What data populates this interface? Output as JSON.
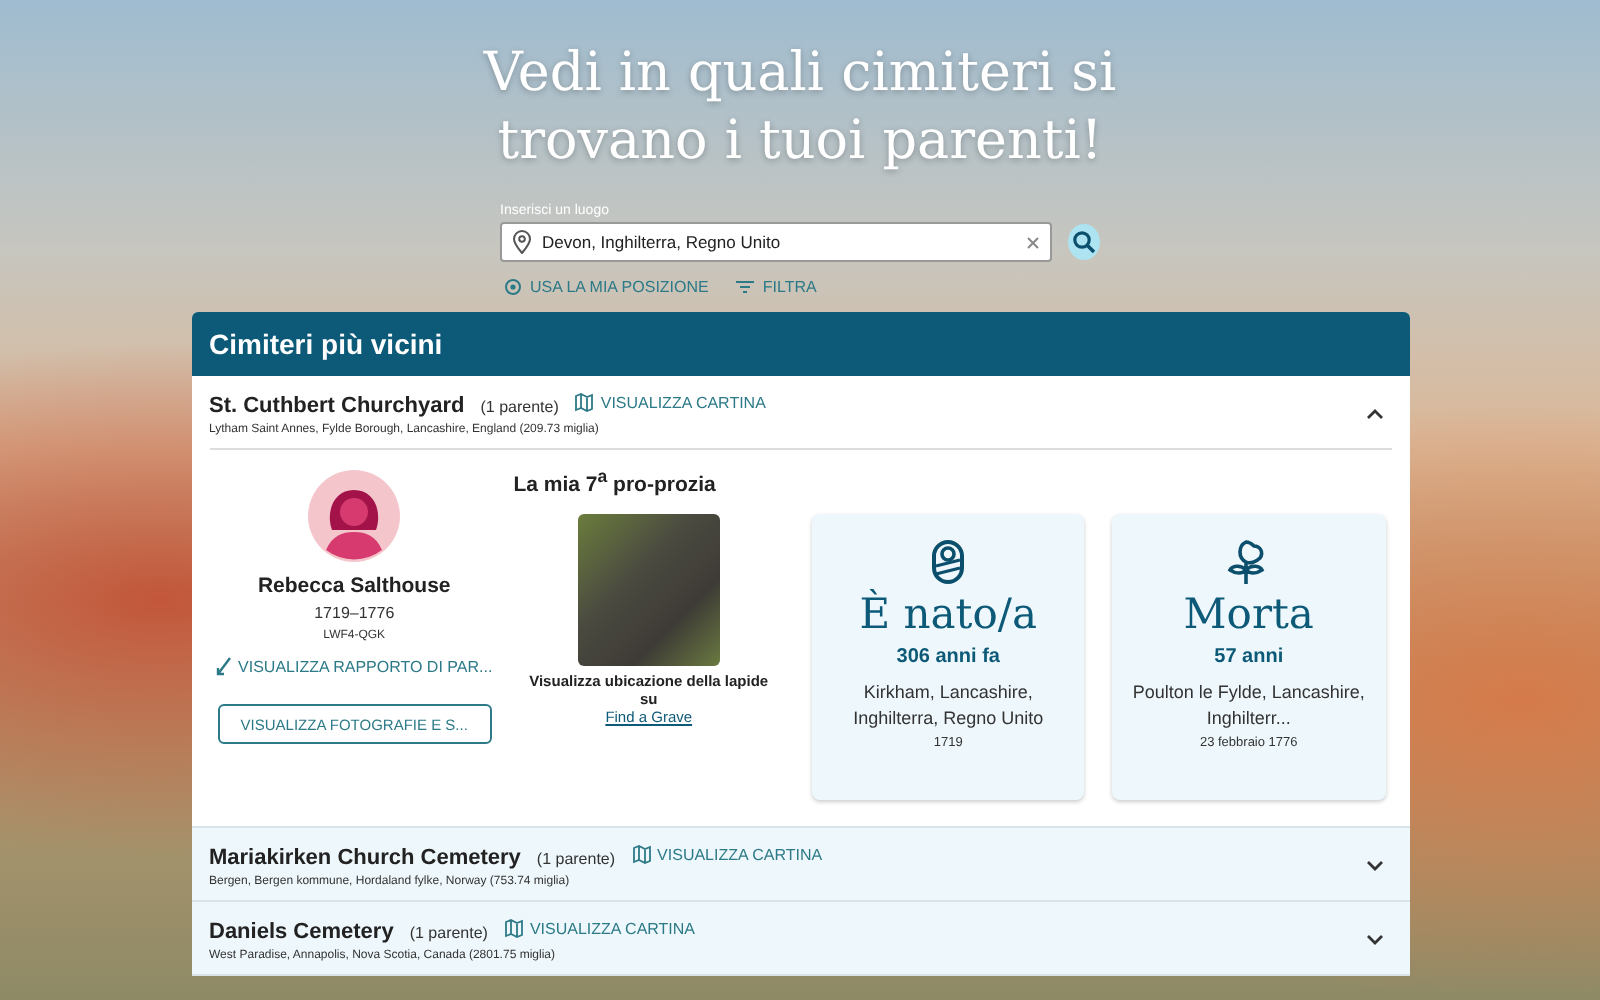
{
  "hero": {
    "title": "Vedi in quali cimiteri si trovano i tuoi parenti!"
  },
  "search": {
    "label": "Inserisci un luogo",
    "value": "Devon, Inghilterra, Regno Unito"
  },
  "search_links": [
    "USA LA MIA POSIZIONE",
    "FILTRA"
  ],
  "panel": {
    "title": "Cimiteri più vicini"
  },
  "cemeteries": [
    {
      "name": "St. Cuthbert Churchyard",
      "count": "(1 parente)",
      "map_link": "VISUALIZZA CARTINA",
      "place": "Lytham Saint Annes, Fylde Borough, Lancashire, England (209.73 miglia)",
      "expanded": true,
      "detail": {
        "person": {
          "name": "Rebecca Salthouse",
          "dates": "1719–1776",
          "id": "LWF4-QGK",
          "relationship_link": "VISUALIZZA RAPPORTO DI PAR...",
          "photos_button": "VISUALIZZA FOTOGRAFIE E S..."
        },
        "relation": "La mia 7$^{a}$ pro-prozia",
        "grave_text": "Visualizza ubicazione della lapide su",
        "grave_link": "Find a Grave",
        "events": [
          {
            "kind": "birth",
            "title": "È nato/a",
            "summary": "306 anni fa",
            "place": "Kirkham, Lancashire, Inghilterra, Regno Unito",
            "date": "1719"
          },
          {
            "kind": "death",
            "title": "Morta",
            "summary": "57 anni",
            "place": "Poulton le Fylde, Lancashire, Inghilterr...",
            "date": "23 febbraio 1776"
          }
        ]
      }
    },
    {
      "name": "Mariakirken Church Cemetery",
      "count": "(1 parente)",
      "map_link": "VISUALIZZA CARTINA",
      "place": "Bergen, Bergen kommune, Hordaland fylke, Norway (753.74 miglia)",
      "expanded": false
    },
    {
      "name": "Daniels Cemetery",
      "count": "(1 parente)",
      "map_link": "VISUALIZZA CARTINA",
      "place": "West Paradise, Annapolis, Nova Scotia, Canada (2801.75 miglia)",
      "expanded": false
    }
  ]
}
